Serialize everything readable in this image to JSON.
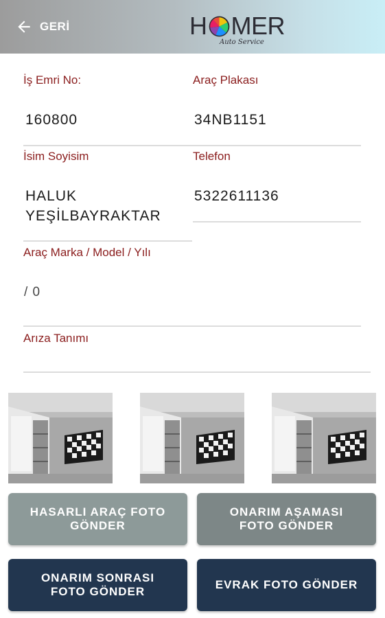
{
  "header": {
    "back_label": "GERİ",
    "logo_text_pre": "H",
    "logo_text_post": "MER",
    "logo_subtitle": "Auto Service"
  },
  "form": {
    "work_order": {
      "label": "İş Emri No:",
      "value": "160800"
    },
    "plate": {
      "label": "Araç Plakası",
      "value": "34NB1151"
    },
    "name": {
      "label": "İsim Soyisim",
      "value_line1": "HALUK",
      "value_line2": "YEŞİLBAYRAKTAR"
    },
    "phone": {
      "label": "Telefon",
      "value": "5322611136"
    },
    "vehicle": {
      "label": "Araç Marka / Model / Yılı",
      "value": "/ 0"
    },
    "fault": {
      "label": "Arıza Tanımı",
      "value": ""
    }
  },
  "photos": {
    "count": 3
  },
  "buttons": {
    "damaged_line1": "HASARLI ARAÇ FOTO",
    "damaged_line2": "GÖNDER",
    "repair_stage_line1": "ONARIM AŞAMASI",
    "repair_stage_line2": "FOTO GÖNDER",
    "after_repair_line1": "ONARIM SONRASI",
    "after_repair_line2": "FOTO GÖNDER",
    "document": "EVRAK FOTO GÖNDER"
  },
  "colors": {
    "label_red": "#8a1c1c",
    "button_gray": "#8d9a99",
    "button_navy": "#22364f"
  }
}
